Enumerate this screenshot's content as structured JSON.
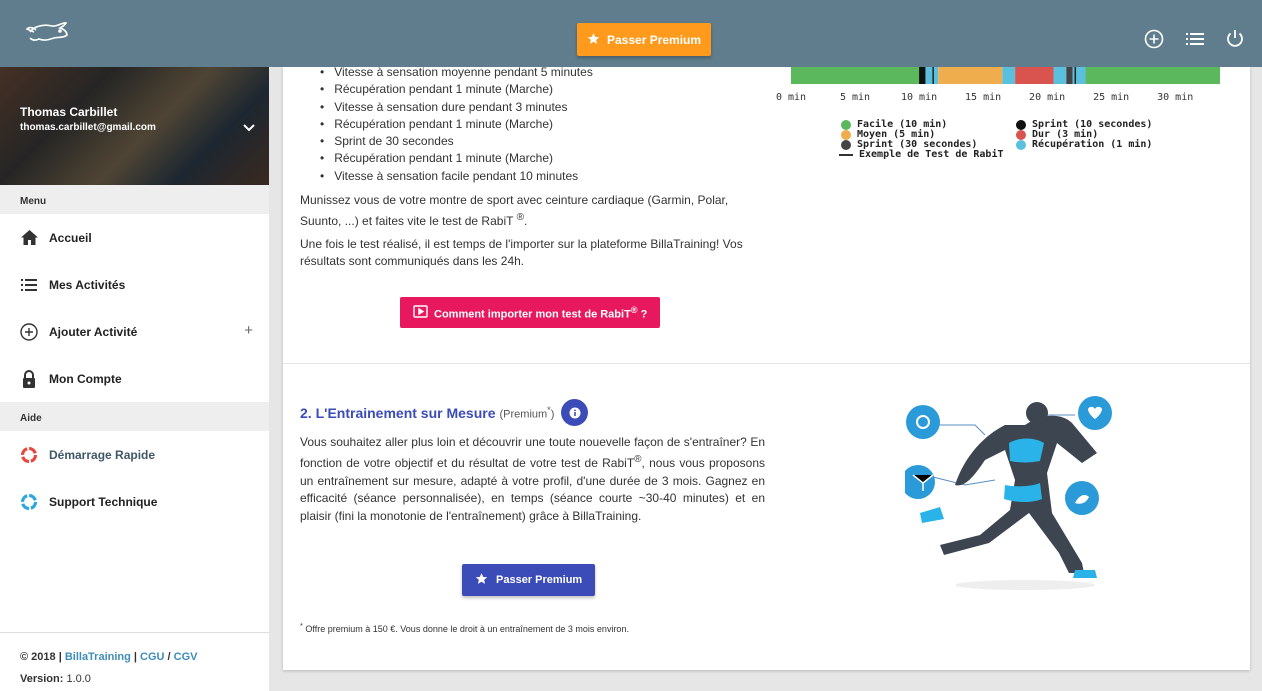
{
  "header": {
    "premium_label": "Passer Premium"
  },
  "user": {
    "name": "Thomas Carbillet",
    "email": "thomas.carbillet@gmail.com"
  },
  "sidebar": {
    "menu_title": "Menu",
    "items": [
      {
        "label": "Accueil"
      },
      {
        "label": "Mes Activités"
      },
      {
        "label": "Ajouter Activité"
      },
      {
        "label": "Mon Compte"
      }
    ],
    "help_title": "Aide",
    "help_items": [
      {
        "label": "Démarrage Rapide"
      },
      {
        "label": "Support Technique"
      }
    ],
    "footer": {
      "copyright": "© 2018 | ",
      "brand": "BillaTraining",
      "sep1": " | ",
      "cgu": "CGU",
      "sep2": " / ",
      "cgv": "CGV",
      "version_label": "Version:",
      "version": " 1.0.0"
    }
  },
  "test": {
    "steps": [
      "Vitesse à sensation moyenne pendant 5 minutes",
      "Récupération pendant 1 minute (Marche)",
      "Vitesse à sensation dure pendant 3 minutes",
      "Récupération pendant 1 minute (Marche)",
      "Sprint de 30 secondes",
      "Récupération pendant 1 minute (Marche)",
      "Vitesse à sensation facile pendant 10 minutes"
    ],
    "para1": "Munissez vous de votre montre de sport avec ceinture cardiaque (Garmin, Polar, Suunto, ...) et faites vite le test de RabiT",
    "para1_sup": "®",
    "para1_end": ".",
    "para2": "Une fois le test réalisé, il est temps de l'importer sur la plateforme BillaTraining! Vos résultats sont communiqués dans les 24h.",
    "import_label": "Comment importer mon test de RabiT",
    "import_sup": "®",
    "import_end": " ?"
  },
  "chart_data": {
    "type": "bar",
    "x_ticks": [
      "0 min",
      "5 min",
      "10 min",
      "15 min",
      "20 min",
      "25 min",
      "30 min"
    ],
    "xlim": [
      0,
      33.5
    ],
    "segments": [
      {
        "phase": "Facile",
        "start": 0,
        "end": 10
      },
      {
        "phase": "Sprint",
        "start": 10,
        "end": 10.5
      },
      {
        "phase": "Récupération",
        "start": 10.5,
        "end": 11.5
      },
      {
        "phase": "Moyen",
        "start": 11.5,
        "end": 16.5
      },
      {
        "phase": "Récupération",
        "start": 16.5,
        "end": 17.5
      },
      {
        "phase": "Dur",
        "start": 17.5,
        "end": 20.5
      },
      {
        "phase": "Récupération",
        "start": 20.5,
        "end": 21.5
      },
      {
        "phase": "Sprint (30 secondes)",
        "start": 21.5,
        "end": 22
      },
      {
        "phase": "Récupération",
        "start": 22,
        "end": 23
      },
      {
        "phase": "Facile",
        "start": 23,
        "end": 33.5
      }
    ],
    "markers": [
      11.1,
      22.2
    ],
    "legend": [
      {
        "label": "Facile (10 min)",
        "color": "#5cb85c"
      },
      {
        "label": "Moyen (5 min)",
        "color": "#f0ad4e"
      },
      {
        "label": "Sprint (30 secondes)",
        "color": "#444444"
      },
      {
        "label": "Exemple de Test de RabiT",
        "color": "#333333",
        "line": true
      },
      {
        "label": "Sprint (10 secondes)",
        "color": "#111111"
      },
      {
        "label": "Dur (3 min)",
        "color": "#d9534f"
      },
      {
        "label": "Récupération (1 min)",
        "color": "#5bc0de"
      }
    ]
  },
  "premium": {
    "title": "2. L'Entrainement sur Mesure",
    "title_note": "(Premium",
    "title_note_sup": "*",
    "title_note_end": ")",
    "desc_a": "Vous souhaitez aller plus loin et découvrir une toute nouevelle façon de s'entraîner? En fonction de votre objectif et du résultat de votre test de RabiT",
    "desc_sup": "®",
    "desc_b": ", nous vous proposons un entraînement sur mesure, adapté à votre profil, d'une durée de 3 mois. Gagnez en efficacité (séance personnalisée), en temps (séance courte ~30-40 minutes) et en plaisir (fini la monotonie de l'entraînement) grâce à BillaTraining.",
    "button": "Passer Premium",
    "note_sup": "*",
    "note": " Offre premium à 150 €. Vous donne le droit à un entraînement de 3 mois environ."
  }
}
